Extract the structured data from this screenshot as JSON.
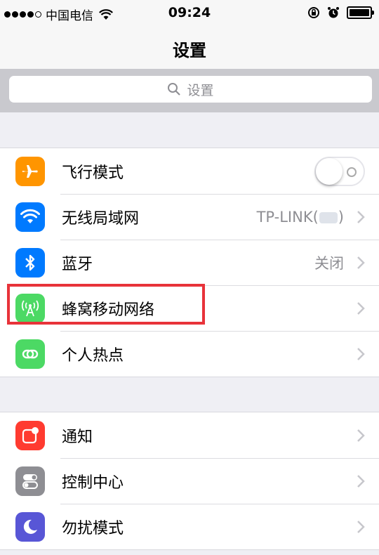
{
  "status_bar": {
    "carrier": "中国电信",
    "time": "09:24"
  },
  "nav": {
    "title": "设置"
  },
  "search": {
    "placeholder": "设置"
  },
  "group1": [
    {
      "label": "飞行模式",
      "icon": "airplane-icon",
      "color": "#ff9500",
      "type": "toggle",
      "toggle_on": false
    },
    {
      "label": "无线局域网",
      "icon": "wifi-icon",
      "color": "#007aff",
      "value": "TP-LINK(",
      "value_suffix": ")"
    },
    {
      "label": "蓝牙",
      "icon": "bluetooth-icon",
      "color": "#007aff",
      "value": "关闭"
    },
    {
      "label": "蜂窝移动网络",
      "icon": "cellular-icon",
      "color": "#4cd964"
    },
    {
      "label": "个人热点",
      "icon": "hotspot-icon",
      "color": "#4cd964"
    }
  ],
  "group2": [
    {
      "label": "通知",
      "icon": "notifications-icon",
      "color": "#ff3b30"
    },
    {
      "label": "控制中心",
      "icon": "control-center-icon",
      "color": "#8e8e93"
    },
    {
      "label": "勿扰模式",
      "icon": "do-not-disturb-icon",
      "color": "#5856d6"
    }
  ]
}
